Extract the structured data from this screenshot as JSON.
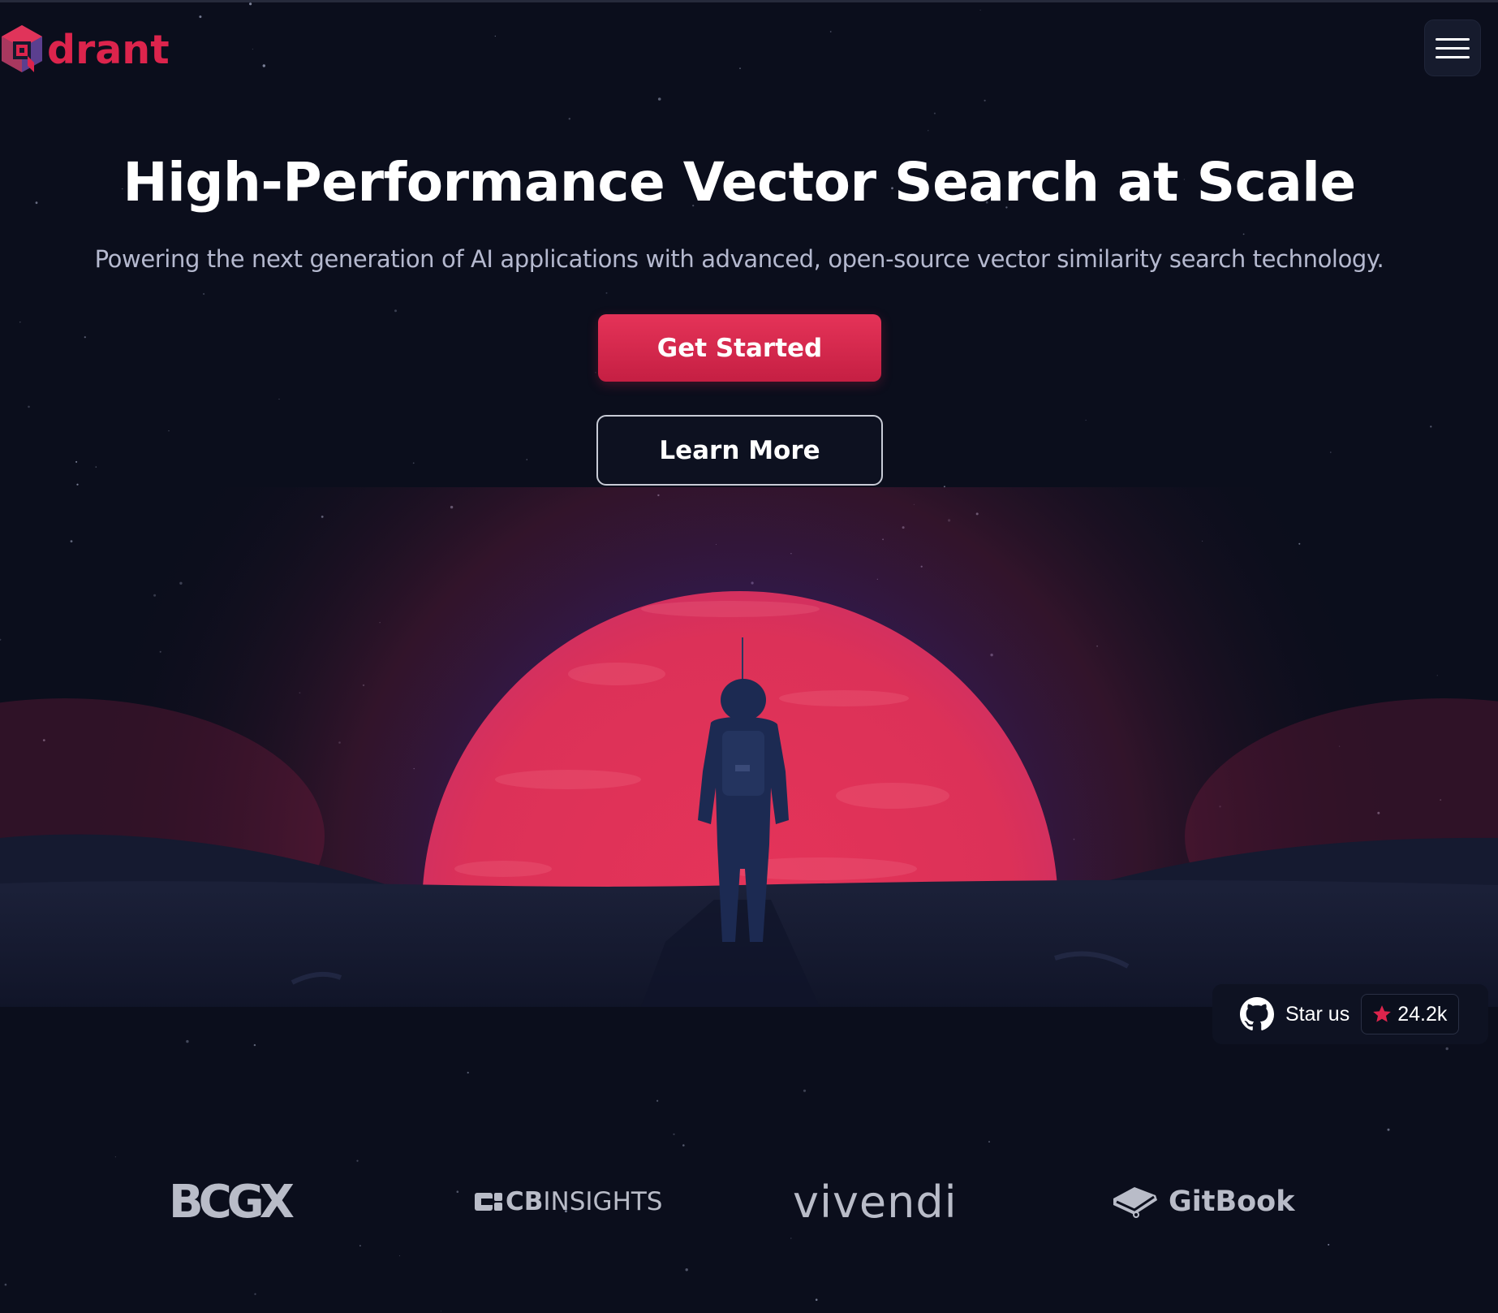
{
  "header": {
    "logo_text": "drant",
    "menu_button_icon": "hamburger-menu-icon"
  },
  "hero": {
    "title": "High-Performance Vector Search at Scale",
    "subtitle": "Powering the next generation of AI applications with advanced, open-source vector similarity search technology.",
    "primary_button": "Get Started",
    "secondary_button": "Learn More"
  },
  "github": {
    "icon": "github-icon",
    "label": "Star us",
    "star_icon": "star-icon",
    "count": "24.2k"
  },
  "partners": [
    {
      "name": "BCG X",
      "text": "BCGX"
    },
    {
      "name": "CB Insights",
      "text_bold": "CB",
      "text_light": "INSIGHTS"
    },
    {
      "name": "Vivendi",
      "text": "vivendi"
    },
    {
      "name": "GitBook",
      "text": "GitBook"
    }
  ],
  "colors": {
    "background": "#0b0e1c",
    "brand": "#dc244c",
    "planet": "#e0345a",
    "muted_text": "#b5b9cf"
  }
}
